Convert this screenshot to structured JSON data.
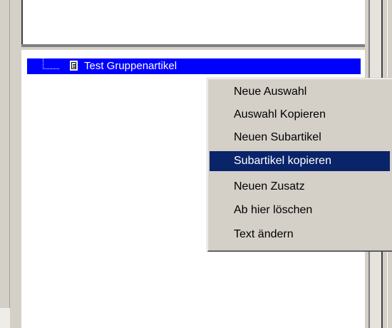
{
  "tree": {
    "selected_item": "Test Gruppenartikel"
  },
  "context_menu": {
    "items": [
      {
        "label": "Neue Auswahl",
        "highlighted": false
      },
      {
        "label": "Auswahl Kopieren",
        "highlighted": false
      },
      {
        "label": "Neuen Subartikel",
        "highlighted": false
      },
      {
        "label": "Subartikel kopieren",
        "highlighted": true
      },
      {
        "label": "Neuen Zusatz",
        "highlighted": false
      },
      {
        "label": "Ab hier löschen",
        "highlighted": false
      },
      {
        "label": "Text ändern",
        "highlighted": false
      }
    ]
  },
  "colors": {
    "selection": "#0000ff",
    "menu_highlight": "#0a246a",
    "menu_background": "#d4d0c8",
    "panel_background": "#ffffff"
  },
  "icons": {
    "tree_item_icon": "document-icon"
  }
}
